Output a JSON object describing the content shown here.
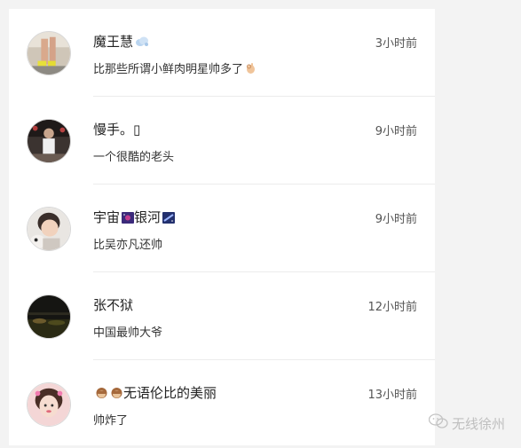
{
  "comments": [
    {
      "name": "魔王慧",
      "name_emoji": "cloud-emoji-icon",
      "time": "3小时前",
      "text": "比那些所谓小鲜肉明星帅多了",
      "text_emoji": "ok-hand-emoji-icon"
    },
    {
      "name": "慢手。▯",
      "time": "9小时前",
      "text": "一个很酷的老头"
    },
    {
      "name_part1": "宇宙",
      "name_part2": "银河",
      "name_emoji": "galaxy-emoji-icon",
      "time": "9小时前",
      "text": "比吴亦凡还帅"
    },
    {
      "name": "张不狱",
      "time": "12小时前",
      "text": "中国最帅大爷"
    },
    {
      "name": "无语伦比的美丽",
      "name_emoji": "see-no-evil-monkey-emoji-icon",
      "time": "13小时前",
      "text": "帅炸了"
    }
  ],
  "watermark": {
    "text": "无线徐州",
    "icon": "wechat-icon"
  },
  "colors": {
    "background": "#f3f3f3",
    "panel": "#ffffff",
    "divider": "#ececec"
  }
}
